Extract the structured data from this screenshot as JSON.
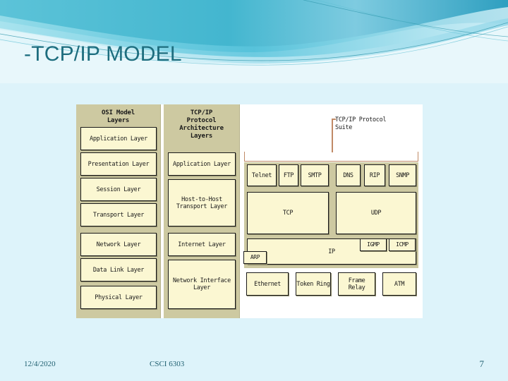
{
  "slide": {
    "title": "-TCP/IP MODEL",
    "accent_color": "#1d6d7e",
    "background_color": "#ddf3fa"
  },
  "diagram": {
    "panel_color": "#cdc9a1",
    "box_color": "#fbf7d2",
    "bracket_color": "#c08a66",
    "osi_column": {
      "heading": "OSI Model\nLayers",
      "heading_line1": "OSI Model",
      "heading_line2": "Layers",
      "layers": [
        "Application Layer",
        "Presentation Layer",
        "Session Layer",
        "Transport Layer",
        "Network Layer",
        "Data Link Layer",
        "Physical Layer"
      ]
    },
    "tcpip_column": {
      "heading_line1": "TCP/IP",
      "heading_line2": "Protocol",
      "heading_line3": "Architecture",
      "heading_line4": "Layers",
      "layers": [
        "Application Layer",
        "Host-to-Host Transport Layer",
        "Internet Layer",
        "Network Interface Layer"
      ]
    },
    "suite_label_line1": "TCP/IP Protocol",
    "suite_label_line2": "Suite",
    "protocols": {
      "application_left": [
        "Telnet",
        "FTP",
        "SMTP"
      ],
      "application_right": [
        "DNS",
        "RIP",
        "SNMP"
      ],
      "transport": [
        "TCP",
        "UDP"
      ],
      "internet_main": "IP",
      "internet_side": [
        "IGMP",
        "ICMP"
      ],
      "internet_arp": "ARP",
      "network_interface": [
        "Ethernet",
        "Token Ring",
        "Frame Relay",
        "ATM"
      ]
    }
  },
  "footer": {
    "date": "12/4/2020",
    "course": "CSCI 6303",
    "page_number": "7"
  }
}
